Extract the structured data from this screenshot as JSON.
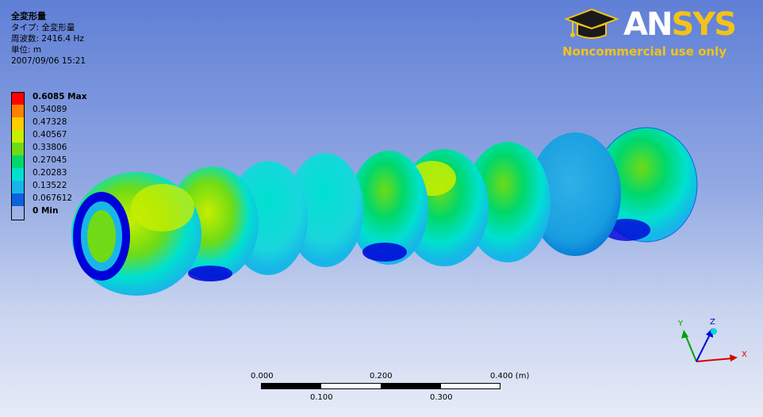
{
  "result": {
    "title": "全変形量",
    "type_line": "タイプ: 全変形量",
    "frequency_line": "周波数: 2416.4 Hz",
    "unit_line": "単位: m",
    "timestamp": "2007/09/06 15:21"
  },
  "legend": {
    "entries": [
      {
        "label": "0.6085 Max",
        "color": "#ff0000",
        "bold": true
      },
      {
        "label": "0.54089",
        "color": "#ff7f00",
        "bold": false
      },
      {
        "label": "0.47328",
        "color": "#ffcc00",
        "bold": false
      },
      {
        "label": "0.40567",
        "color": "#c8ee00",
        "bold": false
      },
      {
        "label": "0.33806",
        "color": "#6edb16",
        "bold": false
      },
      {
        "label": "0.27045",
        "color": "#00d86a",
        "bold": false
      },
      {
        "label": "0.20283",
        "color": "#00e0d0",
        "bold": false
      },
      {
        "label": "0.13522",
        "color": "#18b6e8",
        "bold": false
      },
      {
        "label": "0.067612",
        "color": "#0a62e0",
        "bold": false
      },
      {
        "label": "0 Min",
        "color": "#0000d8",
        "bold": true
      }
    ]
  },
  "logo": {
    "brand_an": "AN",
    "brand_sys": "SYS",
    "note": "Noncommercial use only"
  },
  "triad": {
    "x": "X",
    "y": "Y",
    "z": "Z"
  },
  "scale_bar": {
    "top_labels": [
      "0.000",
      "0.200",
      "0.400 (m)"
    ],
    "bottom_labels": [
      "0.100",
      "0.300"
    ]
  }
}
